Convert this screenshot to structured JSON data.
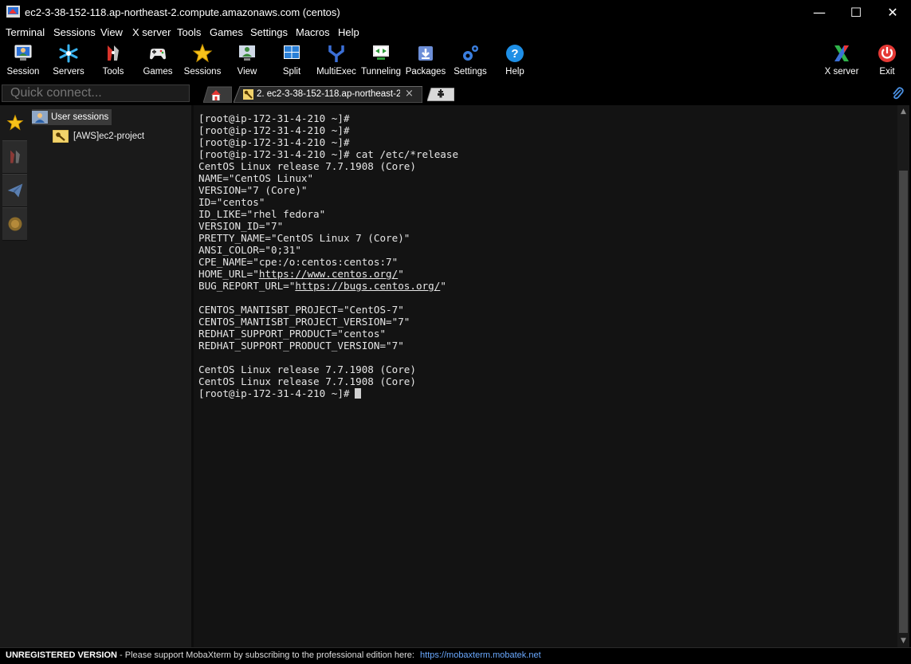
{
  "window": {
    "title": "ec2-3-38-152-118.ap-northeast-2.compute.amazonaws.com (centos)",
    "controls": {
      "minimize": "—",
      "maximize": "☐",
      "close": "✕"
    }
  },
  "menu": [
    "Terminal",
    "Sessions",
    "View",
    "X server",
    "Tools",
    "Games",
    "Settings",
    "Macros",
    "Help"
  ],
  "toolbar": {
    "session": "Session",
    "servers": "Servers",
    "tools": "Tools",
    "games": "Games",
    "sessions": "Sessions",
    "view": "View",
    "split": "Split",
    "multiexec": "MultiExec",
    "tunneling": "Tunneling",
    "packages": "Packages",
    "settings": "Settings",
    "help": "Help",
    "xserver": "X server",
    "exit": "Exit"
  },
  "quick_connect": {
    "placeholder": "Quick connect..."
  },
  "sessions_tree": {
    "root": "User sessions",
    "items": [
      "[AWS]ec2-project"
    ]
  },
  "tabs": {
    "active": "2. ec2-3-38-152-118.ap-northeast-2.compute.amazonaws.com",
    "close": "×",
    "new": "+"
  },
  "terminal": {
    "lines": [
      "[root@ip-172-31-4-210 ~]#",
      "[root@ip-172-31-4-210 ~]#",
      "[root@ip-172-31-4-210 ~]#",
      "[root@ip-172-31-4-210 ~]# cat /etc/*release",
      "CentOS Linux release 7.7.1908 (Core)",
      "NAME=\"CentOS Linux\"",
      "VERSION=\"7 (Core)\"",
      "ID=\"centos\"",
      "ID_LIKE=\"rhel fedora\"",
      "VERSION_ID=\"7\"",
      "PRETTY_NAME=\"CentOS Linux 7 (Core)\"",
      "ANSI_COLOR=\"0;31\"",
      "CPE_NAME=\"cpe:/o:centos:centos:7\""
    ],
    "home_url_prefix": "HOME_URL=\"",
    "home_url": "https://www.centos.org/",
    "bug_url_prefix": "BUG_REPORT_URL=\"",
    "bug_url": "https://bugs.centos.org/",
    "quote": "\"",
    "lines2": [
      "",
      "CENTOS_MANTISBT_PROJECT=\"CentOS-7\"",
      "CENTOS_MANTISBT_PROJECT_VERSION=\"7\"",
      "REDHAT_SUPPORT_PRODUCT=\"centos\"",
      "REDHAT_SUPPORT_PRODUCT_VERSION=\"7\"",
      "",
      "CentOS Linux release 7.7.1908 (Core)",
      "CentOS Linux release 7.7.1908 (Core)"
    ],
    "prompt": "[root@ip-172-31-4-210 ~]#"
  },
  "status": {
    "label": "UNREGISTERED VERSION",
    "message": " -  Please support MobaXterm by subscribing to the professional edition here: ",
    "link": "https://mobaxterm.mobatek.net"
  },
  "colors": {
    "accent_blue": "#6aa9ff",
    "terminal_bg": "#131313"
  }
}
